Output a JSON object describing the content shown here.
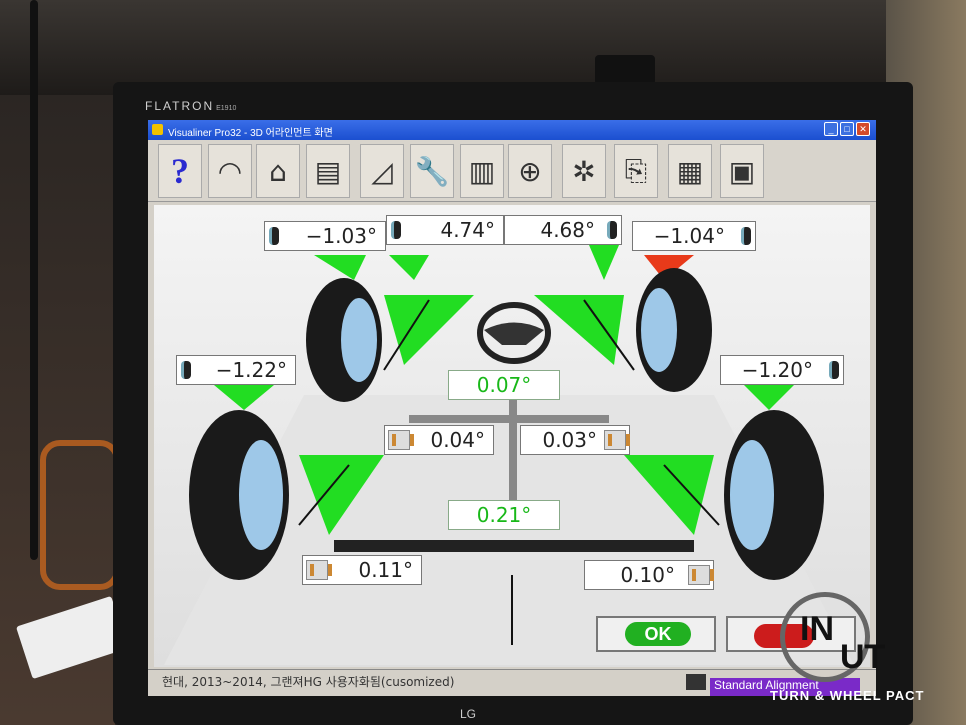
{
  "monitor": {
    "brand": "FLATRON",
    "model": "E1910",
    "maker": "LG"
  },
  "window": {
    "title": "Visualiner Pro32  -  3D 어라인먼트 화면",
    "buttons": [
      "_",
      "□",
      "✕"
    ]
  },
  "toolbar": {
    "items": [
      {
        "name": "help-icon",
        "glyph": "?"
      },
      {
        "name": "gauge-icon",
        "glyph": "◠"
      },
      {
        "name": "home-icon",
        "glyph": "⌂"
      },
      {
        "name": "printer-icon",
        "glyph": "▤"
      },
      {
        "name": "adjust-angle-icon",
        "glyph": "◿"
      },
      {
        "name": "wrench-icon",
        "glyph": "🔧"
      },
      {
        "name": "film-strip-icon",
        "glyph": "▥"
      },
      {
        "name": "zoom-icon",
        "glyph": "⊕"
      },
      {
        "name": "chain-icon",
        "glyph": "✲"
      },
      {
        "name": "report-icon",
        "glyph": "⎘"
      },
      {
        "name": "table-icon",
        "glyph": "▦"
      },
      {
        "name": "vehicle-spec-icon",
        "glyph": "▣"
      }
    ]
  },
  "readings": {
    "front_left_camber": "−1.03°",
    "front_left_caster": "4.74°",
    "front_right_caster": "4.68°",
    "front_right_camber": "−1.04°",
    "rear_left_camber": "−1.22°",
    "rear_right_camber": "−1.20°",
    "front_total_toe": "0.07°",
    "front_left_toe": "0.04°",
    "front_right_toe": "0.03°",
    "thrust_angle": "0.21°",
    "rear_left_toe": "0.11°",
    "rear_right_toe": "0.10°"
  },
  "status": {
    "vehicle": "현대, 2013~2014, 그랜져HG 사용자화됨(cusomized)",
    "mode": "Standard Alignment"
  },
  "actions": {
    "ok_label": "OK"
  },
  "watermark": {
    "in": "IN",
    "ut": "UT",
    "tag": "TURN & WHEEL PACT"
  },
  "colors": {
    "in_spec": "#22dd22",
    "out_of_spec": "#e83a1a",
    "title_bar": "#1b4fd0"
  }
}
